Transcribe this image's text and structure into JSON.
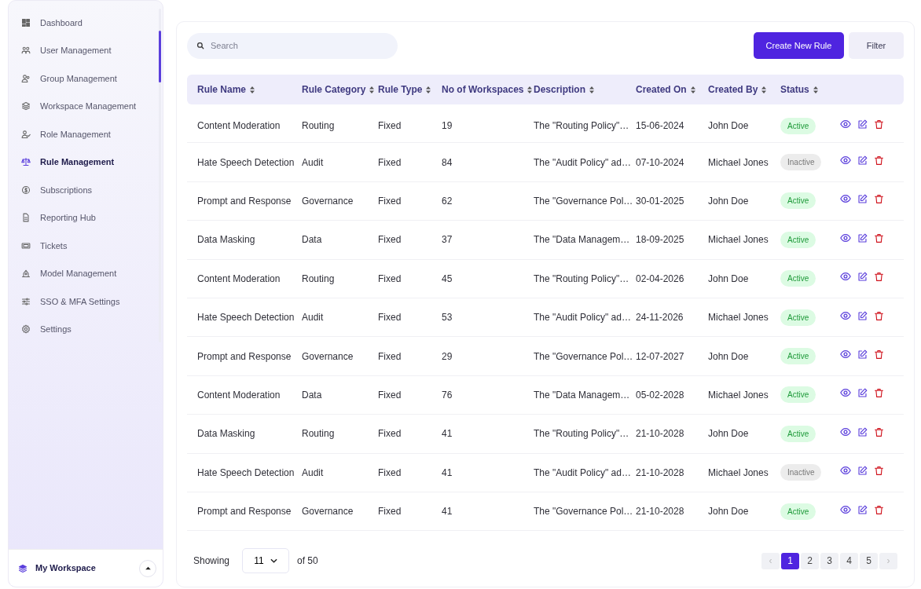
{
  "sidebar": {
    "items": [
      {
        "label": "Dashboard",
        "selected": false
      },
      {
        "label": "User Management",
        "selected": false
      },
      {
        "label": "Group Management",
        "selected": false
      },
      {
        "label": "Workspace Management",
        "selected": false
      },
      {
        "label": "Role Management",
        "selected": false
      },
      {
        "label": "Rule Management",
        "selected": true
      },
      {
        "label": "Subscriptions",
        "selected": false
      },
      {
        "label": "Reporting Hub",
        "selected": false
      },
      {
        "label": "Tickets",
        "selected": false
      },
      {
        "label": "Model Management",
        "selected": false
      },
      {
        "label": "SSO & MFA Settings",
        "selected": false
      },
      {
        "label": "Settings",
        "selected": false
      }
    ],
    "workspace": {
      "label": "My Workspace"
    }
  },
  "toolbar": {
    "search": {
      "placeholder": "Search"
    },
    "buttons": [
      "Create New Rule",
      "Filter"
    ]
  },
  "table": {
    "columns": [
      "Rule Name",
      "Rule Category",
      "Rule Type",
      "No of Workspaces",
      "Description",
      "Created On",
      "Created By",
      "Status"
    ],
    "rows": [
      {
        "cells": [
          "Content Moderation",
          "Routing",
          "Fixed",
          "19",
          "The \"Routing Policy\"…",
          "15-06-2024",
          "John Doe"
        ],
        "status": "Active",
        "active": true
      },
      {
        "cells": [
          "Hate Speech Detection",
          "Audit",
          "Fixed",
          "84",
          "The \"Audit Policy\" ad…",
          "07-10-2024",
          "Michael Jones"
        ],
        "status": "Inactive",
        "active": false
      },
      {
        "cells": [
          "Prompt and Response",
          "Governance",
          "Fixed",
          "62",
          "The \"Governance Pol…",
          "30-01-2025",
          "John Doe"
        ],
        "status": "Active",
        "active": true
      },
      {
        "cells": [
          "Data Masking",
          "Data",
          "Fixed",
          "37",
          "The \"Data Managem…",
          "18-09-2025",
          "Michael Jones"
        ],
        "status": "Active",
        "active": true
      },
      {
        "cells": [
          "Content Moderation",
          "Routing",
          "Fixed",
          "45",
          "The \"Routing Policy\"…",
          "02-04-2026",
          "John Doe"
        ],
        "status": "Active",
        "active": true
      },
      {
        "cells": [
          "Hate Speech Detection",
          "Audit",
          "Fixed",
          "53",
          "The \"Audit Policy\" ad…",
          "24-11-2026",
          "Michael Jones"
        ],
        "status": "Active",
        "active": true
      },
      {
        "cells": [
          "Prompt and Response",
          "Governance",
          "Fixed",
          "29",
          "The \"Governance Pol…",
          "12-07-2027",
          "John Doe"
        ],
        "status": "Active",
        "active": true
      },
      {
        "cells": [
          "Content Moderation",
          "Data",
          "Fixed",
          "76",
          "The \"Data Managem…",
          "05-02-2028",
          "Michael Jones"
        ],
        "status": "Active",
        "active": true
      },
      {
        "cells": [
          "Data Masking",
          "Routing",
          "Fixed",
          "41",
          "The \"Routing Policy\"…",
          "21-10-2028",
          "John Doe"
        ],
        "status": "Active",
        "active": true
      },
      {
        "cells": [
          "Hate Speech Detection",
          "Audit",
          "Fixed",
          "41",
          "The \"Audit Policy\" ad…",
          "21-10-2028",
          "Michael Jones"
        ],
        "status": "Inactive",
        "active": false
      },
      {
        "cells": [
          "Prompt and Response",
          "Governance",
          "Fixed",
          "41",
          "The \"Governance Pol…",
          "21-10-2028",
          "John Doe"
        ],
        "status": "Active",
        "active": true
      }
    ]
  },
  "footer": {
    "showing_label": "Showing",
    "page_size": "11",
    "total": "of 50",
    "prev": "‹",
    "next": "›",
    "prev_disabled": true,
    "next_disabled": true,
    "pages": [
      {
        "label": "1",
        "selected": true
      },
      {
        "label": "2",
        "selected": false
      },
      {
        "label": "3",
        "selected": false
      },
      {
        "label": "4",
        "selected": false
      },
      {
        "label": "5",
        "selected": false
      }
    ]
  }
}
